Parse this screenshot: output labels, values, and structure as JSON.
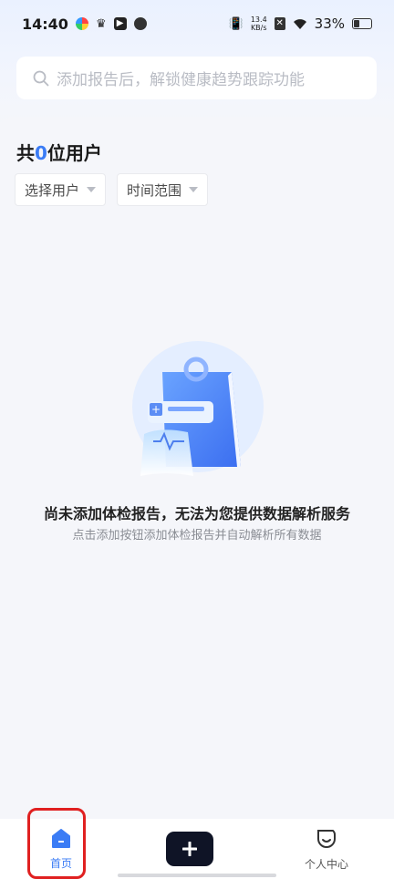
{
  "status_bar": {
    "time": "14:40",
    "net_speed_value": "13.4",
    "net_speed_unit": "KB/s",
    "battery": "33%"
  },
  "search": {
    "placeholder": "添加报告后，解锁健康趋势跟踪功能"
  },
  "users": {
    "prefix": "共",
    "count": "0",
    "suffix": "位用户"
  },
  "filters": [
    {
      "label": "选择用户"
    },
    {
      "label": "时间范围"
    }
  ],
  "empty_state": {
    "title": "尚未添加体检报告，无法为您提供数据解析服务",
    "subtitle": "点击添加按钮添加体检报告并自动解析所有数据"
  },
  "bottom_nav": {
    "home_label": "首页",
    "add_icon": "plus-icon",
    "profile_label": "个人中心"
  },
  "colors": {
    "accent": "#3b7cf5",
    "add_button": "#0f1426",
    "highlight_box": "#e02020"
  }
}
